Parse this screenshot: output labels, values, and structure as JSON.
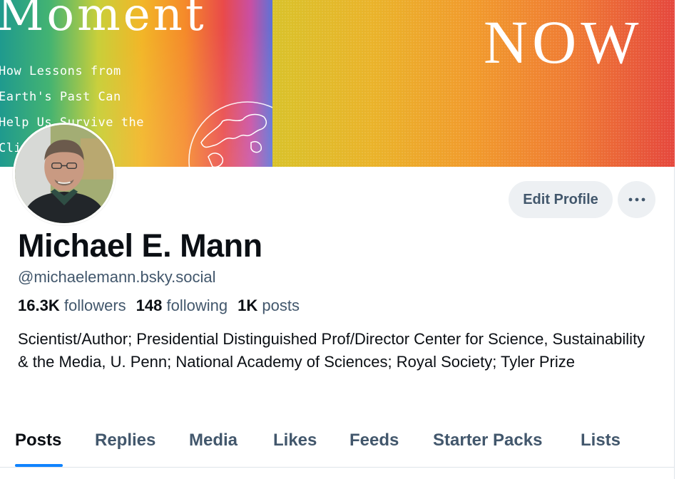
{
  "banner": {
    "cover_title": "Moment",
    "cover_subtitle": "How Lessons from\nEarth's Past Can\nHelp Us Survive the\nCli",
    "now_text": "NOW"
  },
  "profile": {
    "display_name": "Michael E. Mann",
    "handle": "@michaelemann.bsky.social",
    "stats": [
      {
        "value": "16.3K",
        "label": "followers"
      },
      {
        "value": "148",
        "label": "following"
      },
      {
        "value": "1K",
        "label": "posts"
      }
    ],
    "bio": "Scientist/Author; Presidential Distinguished Prof/Director Center for Science, Sustainability & the Media, U. Penn; National Academy of Sciences; Royal Society; Tyler Prize"
  },
  "actions": {
    "edit_profile_label": "Edit Profile",
    "more_icon": "ellipsis-icon"
  },
  "tabs": [
    {
      "label": "Posts",
      "active": true
    },
    {
      "label": "Replies",
      "active": false
    },
    {
      "label": "Media",
      "active": false
    },
    {
      "label": "Likes",
      "active": false
    },
    {
      "label": "Feeds",
      "active": false
    },
    {
      "label": "Starter Packs",
      "active": false
    },
    {
      "label": "Lists",
      "active": false
    }
  ],
  "colors": {
    "accent": "#1083fe",
    "secondary_text": "#42576c",
    "button_bg": "#edf0f3"
  }
}
